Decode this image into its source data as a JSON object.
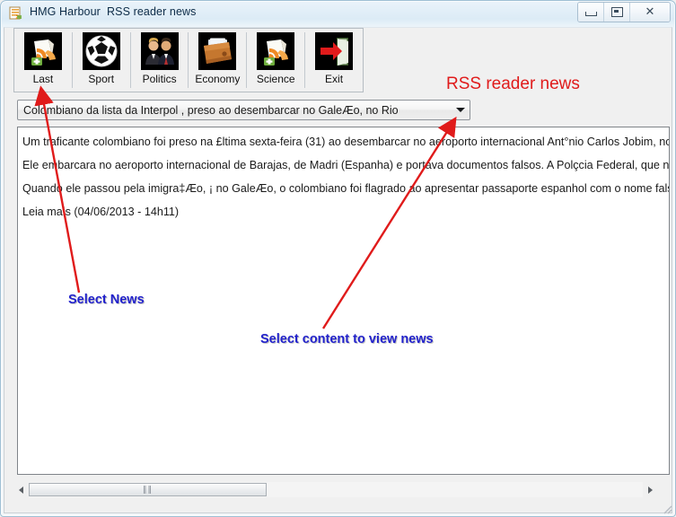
{
  "window": {
    "title": "HMG Harbour  RSS reader news",
    "app_icon": "rss-document-icon",
    "controls": {
      "minimize": "minimize-button",
      "maximize": "restore-button",
      "close": "close-button",
      "close_glyph": "✕"
    }
  },
  "heading": {
    "text": "RSS reader news",
    "color": "#e01b1b"
  },
  "toolbar": {
    "buttons": [
      {
        "label": "Last",
        "icon": "rss-feed-add-icon"
      },
      {
        "label": "Sport",
        "icon": "soccer-ball-icon"
      },
      {
        "label": "Politics",
        "icon": "two-people-icon"
      },
      {
        "label": "Economy",
        "icon": "wallet-icon"
      },
      {
        "label": "Science",
        "icon": "rss-feed-add-icon"
      },
      {
        "label": "Exit",
        "icon": "exit-door-arrow-icon"
      }
    ]
  },
  "combo": {
    "value": "Colombiano da lista da Interpol , preso ao desembarcar no GaleÆo, no Rio",
    "arrow_icon": "chevron-down-icon"
  },
  "article": {
    "lines": [
      "Um traficante colombiano foi preso na £ltima sexta-feira (31) ao desembarcar no aeroporto internacional Ant°nio Carlos Jobim, no",
      "Ele embarcara no aeroporto internacional de Barajas, de Madri (Espanha) e portava documentos falsos. A Polçcia Federal, que nÆ",
      "Quando ele passou pela imigra‡Æo, ¡ no GaleÆo, o colombiano foi flagrado ao apresentar passaporte espanhol com o nome fals",
      "Leia mais (04/06/2013 - 14h11)"
    ]
  },
  "scrollbar": {
    "left_arrow_icon": "scroll-left-arrow-icon",
    "right_arrow_icon": "scroll-right-arrow-icon",
    "grip": "‖‖"
  },
  "annotations": [
    {
      "text": "Select News",
      "color": "#2222cc"
    },
    {
      "text": "Select content to view news",
      "color": "#2222cc"
    }
  ]
}
